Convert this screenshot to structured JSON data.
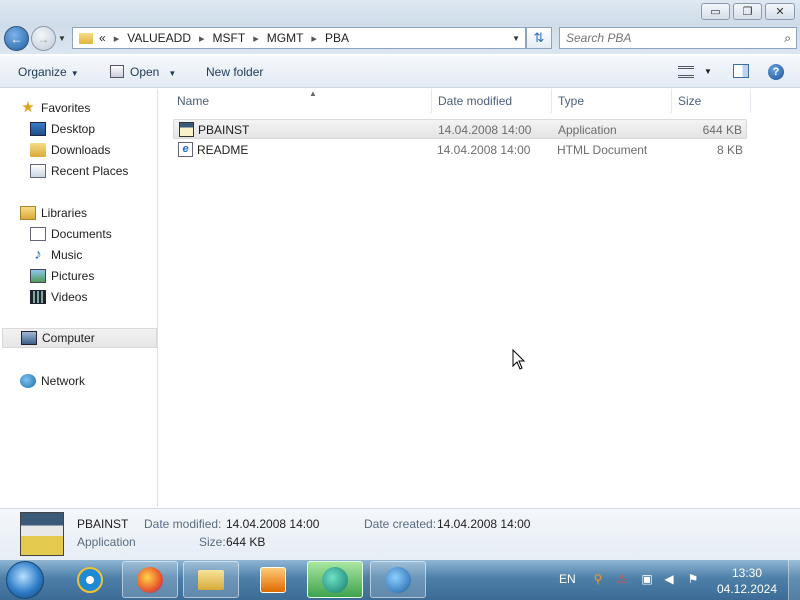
{
  "window": {
    "minimize": "▭",
    "maximize": "❐",
    "close": "✕"
  },
  "address": {
    "overflow": "«",
    "crumbs": [
      "VALUEADD",
      "MSFT",
      "MGMT",
      "PBA"
    ],
    "separator": "▸"
  },
  "search": {
    "placeholder": "Search PBA"
  },
  "toolbar": {
    "organize": "Organize",
    "open": "Open",
    "new_folder": "New folder",
    "help": "?"
  },
  "nav": {
    "favorites": "Favorites",
    "desktop": "Desktop",
    "downloads": "Downloads",
    "recent": "Recent Places",
    "libraries": "Libraries",
    "documents": "Documents",
    "music": "Music",
    "pictures": "Pictures",
    "videos": "Videos",
    "computer": "Computer",
    "network": "Network"
  },
  "columns": {
    "name": "Name",
    "date": "Date modified",
    "type": "Type",
    "size": "Size"
  },
  "files": [
    {
      "name": "PBAINST",
      "date": "14.04.2008 14:00",
      "type": "Application",
      "size": "644 KB",
      "icon": "application-icon",
      "selected": true
    },
    {
      "name": "README",
      "date": "14.04.2008 14:00",
      "type": "HTML Document",
      "size": "8 KB",
      "icon": "html-document-icon",
      "selected": false
    }
  ],
  "details": {
    "name": "PBAINST",
    "kind": "Application",
    "date_modified_label": "Date modified:",
    "date_modified": "14.04.2008 14:00",
    "size_label": "Size:",
    "size": "644 KB",
    "date_created_label": "Date created:",
    "date_created": "14.04.2008 14:00"
  },
  "taskbar": {
    "language": "EN",
    "time": "13:30",
    "date": "04.12.2024"
  },
  "colors": {
    "accent": "#1f5e9f",
    "taskbar": "#4d7fa8",
    "selection": "#e4e4e4"
  }
}
